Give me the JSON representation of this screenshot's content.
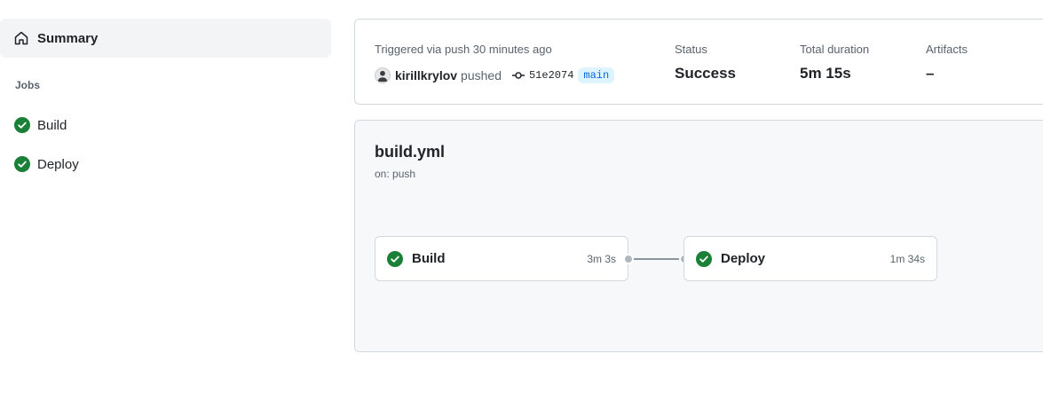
{
  "sidebar": {
    "summary_label": "Summary",
    "jobs_heading": "Jobs",
    "jobs": [
      {
        "label": "Build",
        "status": "success"
      },
      {
        "label": "Deploy",
        "status": "success"
      }
    ]
  },
  "run": {
    "trigger_text": "Triggered via push 30 minutes ago",
    "actor": "kirillkrylov",
    "action": "pushed",
    "commit_sha": "51e2074",
    "branch": "main",
    "status_label": "Status",
    "status_value": "Success",
    "duration_label": "Total duration",
    "duration_value": "5m 15s",
    "artifacts_label": "Artifacts",
    "artifacts_value": "–"
  },
  "workflow": {
    "name": "build.yml",
    "trigger": "on: push",
    "nodes": [
      {
        "name": "Build",
        "duration": "3m 3s",
        "status": "success"
      },
      {
        "name": "Deploy",
        "duration": "1m 34s",
        "status": "success"
      }
    ]
  },
  "colors": {
    "success": "#1a7f37",
    "accent": "#0969da",
    "muted": "#59636e",
    "border": "#d1d9e0"
  },
  "icons": {
    "summary": "home-icon",
    "job_status": "check-circle-icon",
    "commit": "git-commit-icon"
  }
}
